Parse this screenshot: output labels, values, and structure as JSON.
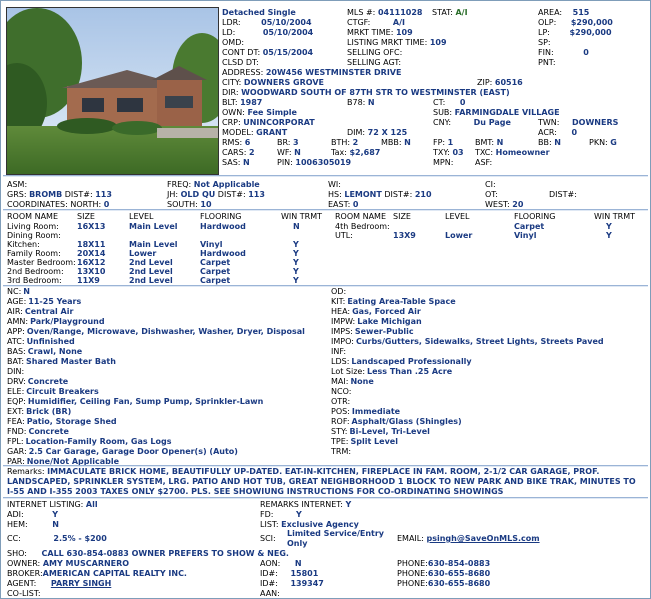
{
  "header": {
    "status_type": "Detached Single",
    "mls": {
      "label": "MLS #:",
      "value": "04111028"
    },
    "stat": {
      "label": "STAT:",
      "value": "A/I"
    },
    "area": {
      "label": "AREA:",
      "value": "515"
    },
    "ldr": {
      "label": "LDR:",
      "value": "05/10/2004"
    },
    "ctgf": {
      "label": "CTGF:",
      "value": "A/I"
    },
    "olp": {
      "label": "OLP:",
      "value": "$290,000"
    },
    "ld": {
      "label": "LD:",
      "value": "05/10/2004"
    },
    "mrkt_time": {
      "label": "MRKT TIME:",
      "value": "109"
    },
    "lp": {
      "label": "LP:",
      "value": "$290,000"
    },
    "omd": {
      "label": "OMD:",
      "value": ""
    },
    "listing_mrkt_time": {
      "label": "LISTING MRKT TIME:",
      "value": "109"
    },
    "sp": {
      "label": "SP:",
      "value": ""
    },
    "cont_dt": {
      "label": "CONT DT:",
      "value": "05/15/2004"
    },
    "selling_ofc": {
      "label": "SELLING OFC:",
      "value": ""
    },
    "fin": {
      "label": "FIN:",
      "value": "0"
    },
    "clsd_dt": {
      "label": "CLSD DT:",
      "value": ""
    },
    "selling_agt": {
      "label": "SELLING AGT:",
      "value": ""
    },
    "pnt": {
      "label": "PNT:",
      "value": ""
    },
    "address": {
      "label": "ADDRESS:",
      "value": "20W456 WESTMINSTER DRIVE"
    },
    "city": {
      "label": "CITY:",
      "value": "DOWNERS GROVE"
    },
    "zip": {
      "label": "ZIP:",
      "value": "60516"
    },
    "dir": {
      "label": "DIR:",
      "value": "WOODWARD SOUTH OF 87TH STR TO WESTMINSTER (EAST)"
    },
    "blt": {
      "label": "BLT:",
      "value": "1987"
    },
    "b78": {
      "label": "B78:",
      "value": "N"
    },
    "ct": {
      "label": "CT:",
      "value": "0"
    },
    "own": {
      "label": "OWN:",
      "value": "Fee Simple"
    },
    "sub": {
      "label": "SUB:",
      "value": "FARMINGDALE VILLAGE"
    },
    "crp": {
      "label": "CRP:",
      "value": "UNINCORPORAT"
    },
    "cny": {
      "label": "CNY:",
      "value": "Du Page"
    },
    "twn": {
      "label": "TWN:",
      "value": "DOWNERS"
    },
    "model": {
      "label": "MODEL:",
      "value": "GRANT"
    },
    "dim": {
      "label": "DIM:",
      "value": "72 X 125"
    },
    "acr": {
      "label": "ACR:",
      "value": "0"
    },
    "rms": {
      "label": "RMS:",
      "value": "6"
    },
    "br": {
      "label": "BR:",
      "value": "3"
    },
    "bth": {
      "label": "BTH:",
      "value": "2"
    },
    "mbb": {
      "label": "MBB:",
      "value": "N"
    },
    "fp": {
      "label": "FP:",
      "value": "1"
    },
    "bmt": {
      "label": "BMT:",
      "value": "N"
    },
    "bb": {
      "label": "BB:",
      "value": "N"
    },
    "pkn": {
      "label": "PKN:",
      "value": "G"
    },
    "cars": {
      "label": "CARS:",
      "value": "2"
    },
    "wf": {
      "label": "WF:",
      "value": "N"
    },
    "tax": {
      "label": "Tax:",
      "value": "$2,687"
    },
    "txy": {
      "label": "TXY:",
      "value": "03"
    },
    "txc": {
      "label": "TXC:",
      "value": "Homeowner"
    },
    "sas": {
      "label": "SAS:",
      "value": "N"
    },
    "pin": {
      "label": "PIN:",
      "value": "1006305019"
    },
    "mpn": {
      "label": "MPN:",
      "value": ""
    },
    "asf": {
      "label": "ASF:",
      "value": ""
    }
  },
  "schools": {
    "asm": {
      "label": "ASM:",
      "value": ""
    },
    "freq": {
      "label": "FREQ:",
      "value": "Not Applicable"
    },
    "wi": {
      "label": "WI:",
      "value": ""
    },
    "ci": {
      "label": "CI:",
      "value": ""
    },
    "grs": {
      "label": "GRS:",
      "value": "BROMB"
    },
    "grs_dist": {
      "label": "DIST#:",
      "value": "113"
    },
    "jh": {
      "label": "JH:",
      "value": "OLD QU"
    },
    "jh_dist": {
      "label": "DIST#:",
      "value": "113"
    },
    "hs": {
      "label": "HS:",
      "value": "LEMONT"
    },
    "hs_dist": {
      "label": "DIST#:",
      "value": "210"
    },
    "ot": {
      "label": "OT:",
      "value": ""
    },
    "ot_dist": {
      "label": "DIST#:",
      "value": ""
    },
    "coords_label": "COORDINATES: NORTH:",
    "north": "0",
    "south": {
      "label": "SOUTH:",
      "value": "10"
    },
    "east": {
      "label": "EAST:",
      "value": "0"
    },
    "west": {
      "label": "WEST:",
      "value": "20"
    }
  },
  "rooms": {
    "headers": [
      "ROOM NAME",
      "SIZE",
      "LEVEL",
      "FLOORING",
      "WIN TRMT"
    ],
    "left": [
      {
        "name": "Living Room:",
        "size": "16X13",
        "level": "Main Level",
        "flooring": "Hardwood",
        "win": "N"
      },
      {
        "name": "Dining Room:",
        "size": "",
        "level": "",
        "flooring": "",
        "win": ""
      },
      {
        "name": "Kitchen:",
        "size": "18X11",
        "level": "Main Level",
        "flooring": "Vinyl",
        "win": "Y"
      },
      {
        "name": "Family Room:",
        "size": "20X14",
        "level": "Lower",
        "flooring": "Hardwood",
        "win": "Y"
      },
      {
        "name": "Master Bedroom:",
        "size": "16X12",
        "level": "2nd Level",
        "flooring": "Carpet",
        "win": "Y"
      },
      {
        "name": "2nd Bedroom:",
        "size": "13X10",
        "level": "2nd Level",
        "flooring": "Carpet",
        "win": "Y"
      },
      {
        "name": "3rd Bedroom:",
        "size": "11X9",
        "level": "2nd Level",
        "flooring": "Carpet",
        "win": "Y"
      }
    ],
    "right": [
      {
        "name": "4th Bedroom:",
        "size": "",
        "level": "",
        "flooring": "Carpet",
        "win": "Y"
      },
      {
        "name": "UTL:",
        "size": "13X9",
        "level": "Lower",
        "flooring": "Vinyl",
        "win": "Y"
      }
    ]
  },
  "features_left": [
    {
      "label": "NC:",
      "value": "N"
    },
    {
      "label": "AGE:",
      "value": "11-25 Years"
    },
    {
      "label": "AIR:",
      "value": "Central Air"
    },
    {
      "label": "AMN:",
      "value": "Park/Playground"
    },
    {
      "label": "APP:",
      "value": "Oven/Range, Microwave, Dishwasher, Washer, Dryer, Disposal"
    },
    {
      "label": "ATC:",
      "value": "Unfinished"
    },
    {
      "label": "BAS:",
      "value": "Crawl, None"
    },
    {
      "label": "BAT:",
      "value": "Shared Master Bath"
    },
    {
      "label": "DIN:",
      "value": ""
    },
    {
      "label": "DRV:",
      "value": "Concrete"
    },
    {
      "label": "ELE:",
      "value": "Circuit Breakers"
    },
    {
      "label": "EQP:",
      "value": "Humidifier, Ceiling Fan, Sump Pump, Sprinkler-Lawn"
    },
    {
      "label": "EXT:",
      "value": "Brick (BR)"
    },
    {
      "label": "FEA:",
      "value": "Patio, Storage Shed"
    },
    {
      "label": "FND:",
      "value": "Concrete"
    },
    {
      "label": "FPL:",
      "value": "Location-Family Room, Gas Logs"
    },
    {
      "label": "GAR:",
      "value": "2.5 Car Garage, Garage Door Opener(s) (Auto)"
    },
    {
      "label": "PAR:",
      "value": "None/Not Applicable"
    }
  ],
  "features_right": [
    {
      "label": "OD:",
      "value": ""
    },
    {
      "label": "KIT:",
      "value": "Eating Area-Table Space"
    },
    {
      "label": "HEA:",
      "value": "Gas, Forced Air"
    },
    {
      "label": "IMPW:",
      "value": "Lake Michigan"
    },
    {
      "label": "IMPS:",
      "value": "Sewer-Public"
    },
    {
      "label": "IMPO:",
      "value": "Curbs/Gutters, Sidewalks, Street Lights, Streets Paved"
    },
    {
      "label": "INF:",
      "value": ""
    },
    {
      "label": "LDS:",
      "value": "Landscaped Professionally"
    },
    {
      "label": "Lot Size:",
      "value": "Less Than .25 Acre"
    },
    {
      "label": "MAI:",
      "value": "None"
    },
    {
      "label": "NCO:",
      "value": ""
    },
    {
      "label": "OTR:",
      "value": ""
    },
    {
      "label": "POS:",
      "value": "Immediate"
    },
    {
      "label": "ROF:",
      "value": "Asphalt/Glass (Shingles)"
    },
    {
      "label": "STY:",
      "value": "Bi-Level, Tri-Level"
    },
    {
      "label": "TPE:",
      "value": "Split Level"
    },
    {
      "label": "TRM:",
      "value": ""
    }
  ],
  "remarks": {
    "label": "Remarks:",
    "text": "IMMACULATE BRICK HOME, BEAUTIFULLY UP-DATED. EAT-IN-KITCHEN, FIREPLACE IN FAM. ROOM, 2-1/2 CAR GARAGE, PROF. LANDSCAPED, SPRINKLER SYSTEM, LRG. PATIO AND HOT TUB, GREAT NEIGHBORHOOD 1 BLOCK TO NEW PARK AND BIKE TRAK, MINUTES TO I-55 AND I-355 2003 TAXES ONLY $2700. PLS. SEE SHOWIUNG INSTRUCTIONS FOR CO-ORDINATING SHOWINGS"
  },
  "agent": {
    "internet_listing": {
      "label": "INTERNET LISTING:",
      "value": "All"
    },
    "remarks_internet": {
      "label": "REMARKS INTERNET:",
      "value": "Y"
    },
    "adi": {
      "label": "ADI:",
      "value": "Y"
    },
    "fd": {
      "label": "FD:",
      "value": "Y"
    },
    "hem": {
      "label": "HEM:",
      "value": "N"
    },
    "list": {
      "label": "LIST:",
      "value": "Exclusive Agency"
    },
    "cc": {
      "label": "CC:",
      "value": "2.5% - $200"
    },
    "sci": {
      "label": "SCI:",
      "value": "Limited Service/Entry Only"
    },
    "email": {
      "label": "EMAIL:",
      "value": "psingh@SaveOnMLS.com"
    },
    "sho": {
      "label": "SHO:",
      "value": "CALL 630-854-0883 OWNER PREFERS TO SHOW & NEG."
    },
    "owner": {
      "label": "OWNER:",
      "value": "AMY MUSCARNERO"
    },
    "aon": {
      "label": "AON:",
      "value": "N"
    },
    "phone1": {
      "label": "PHONE:",
      "value": "630-854-0883"
    },
    "broker": {
      "label": "BROKER:",
      "value": "AMERICAN CAPITAL REALTY INC."
    },
    "broker_id": {
      "label": "ID#:",
      "value": "15801"
    },
    "phone2": {
      "label": "PHONE:",
      "value": "630-655-8680"
    },
    "agent_name": {
      "label": "AGENT:",
      "value": "PARRY SINGH"
    },
    "agent_id": {
      "label": "ID#:",
      "value": "139347"
    },
    "phone3": {
      "label": "PHONE:",
      "value": "630-655-8680"
    },
    "colist": {
      "label": "CO-LIST:",
      "value": ""
    },
    "aan": {
      "label": "AAN:",
      "value": ""
    }
  }
}
